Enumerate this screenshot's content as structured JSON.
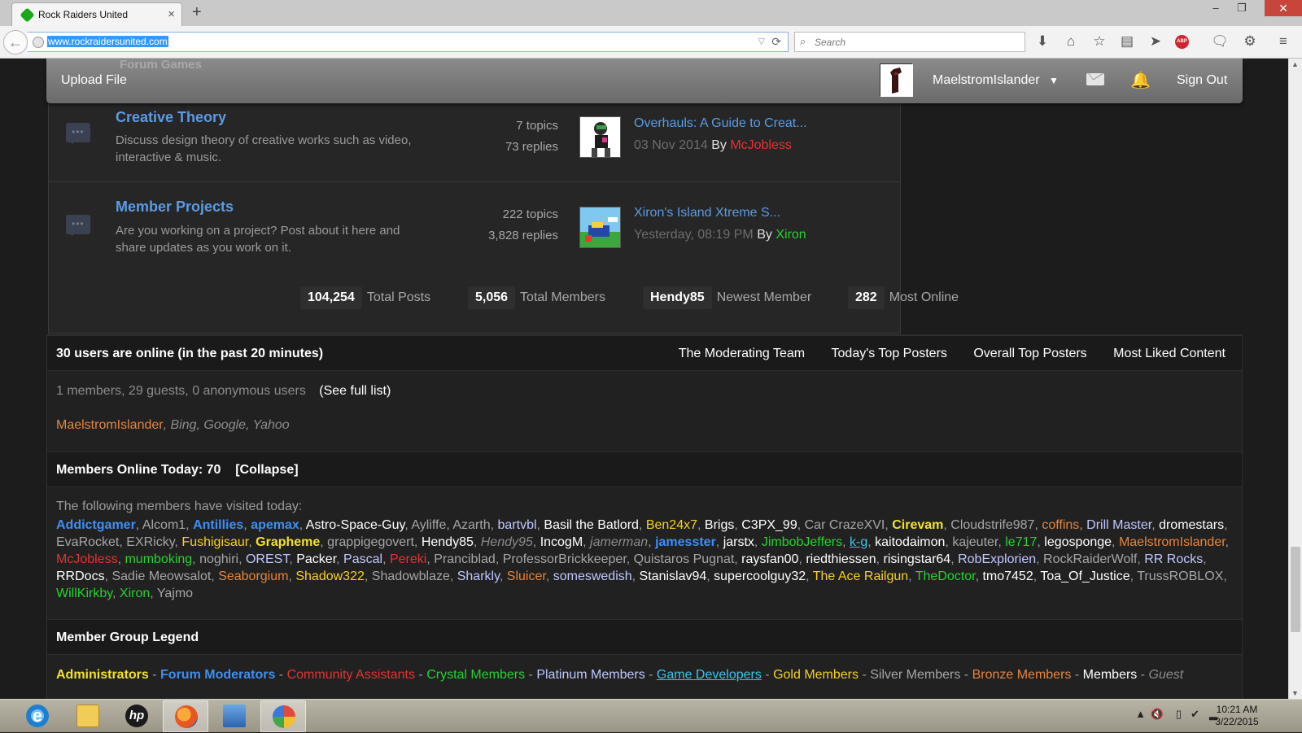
{
  "browser": {
    "tab_title": "Rock Raiders United",
    "tab_close": "×",
    "new_tab": "+",
    "url": "www.rockraidersunited.com",
    "search_placeholder": "Search",
    "window_controls": [
      "–",
      "❐",
      "✕"
    ]
  },
  "sitebar": {
    "breadcrumb_ghost": "Forum Games",
    "upload_label": "Upload File",
    "username": "MaelstromIslander",
    "signout_label": "Sign Out",
    "icons": [
      "mail-icon",
      "bell-icon",
      "caret-down-icon"
    ]
  },
  "forums": [
    {
      "name": "Creative Theory",
      "description": "Discuss design theory of creative works such as video, interactive & music.",
      "topics": "7 topics",
      "replies": "73 replies",
      "last_title": "Overhauls: A Guide to Creat...",
      "last_date": "03 Nov 2014",
      "by": "By",
      "last_user": "McJobless",
      "last_user_color": "#e8302f"
    },
    {
      "name": "Member Projects",
      "description": "Are you working on a project? Post about it here and share updates as you work on it.",
      "topics": "222 topics",
      "replies": "3,828 replies",
      "last_title": "Xiron's Island Xtreme S...",
      "last_date": "Yesterday, 08:19 PM",
      "by": "By",
      "last_user": "Xiron",
      "last_user_color": "#27d32d"
    }
  ],
  "stats": [
    {
      "value": "104,254",
      "label": "Total Posts"
    },
    {
      "value": "5,056",
      "label": "Total Members"
    },
    {
      "value": "Hendy85",
      "label": "Newest Member"
    },
    {
      "value": "282",
      "label": "Most Online"
    }
  ],
  "online": {
    "title": "30 users are online (in the past 20 minutes)",
    "links": [
      "The Moderating Team",
      "Today's Top Posters",
      "Overall Top Posters",
      "Most Liked Content"
    ],
    "counts": "1 members, 29 guests, 0 anonymous users",
    "see_full": "(See full list)",
    "online_user": "MaelstromIslander",
    "bots": ", Bing, Google, Yahoo",
    "today_title": "Members Online Today: 70",
    "collapse": "[Collapse]",
    "visited_intro": "The following members have visited today:",
    "members": [
      {
        "n": "Addictgamer",
        "c": "mod"
      },
      {
        "n": "Alcom1",
        "c": "silver"
      },
      {
        "n": "Antillies",
        "c": "mod"
      },
      {
        "n": "apemax",
        "c": "mod"
      },
      {
        "n": "Astro-Space-Guy",
        "c": "member"
      },
      {
        "n": "Ayliffe",
        "c": "silver"
      },
      {
        "n": "Azarth",
        "c": "silver"
      },
      {
        "n": "bartvbl",
        "c": "plat"
      },
      {
        "n": "Basil the Batlord",
        "c": "member"
      },
      {
        "n": "Ben24x7",
        "c": "gold"
      },
      {
        "n": "Brigs",
        "c": "member"
      },
      {
        "n": "C3PX_99",
        "c": "member"
      },
      {
        "n": "Car CrazeXVI",
        "c": "silver"
      },
      {
        "n": "Cirevam",
        "c": "admin"
      },
      {
        "n": "Cloudstrife987",
        "c": "silver"
      },
      {
        "n": "coffins",
        "c": "bronze"
      },
      {
        "n": "Drill Master",
        "c": "plat"
      },
      {
        "n": "dromestars",
        "c": "member"
      },
      {
        "n": "EvaRocket",
        "c": "silver"
      },
      {
        "n": "EXRicky",
        "c": "silver"
      },
      {
        "n": "Fushigisaur",
        "c": "gold"
      },
      {
        "n": "Grapheme",
        "c": "admin"
      },
      {
        "n": "grappigegovert",
        "c": "silver"
      },
      {
        "n": "Hendy85",
        "c": "member"
      },
      {
        "n": "Hendy95",
        "c": "guest"
      },
      {
        "n": "IncogM",
        "c": "member"
      },
      {
        "n": "jamerman",
        "c": "guest"
      },
      {
        "n": "jamesster",
        "c": "mod"
      },
      {
        "n": "jarstx",
        "c": "member"
      },
      {
        "n": "JimbobJeffers",
        "c": "crystal"
      },
      {
        "n": "k-g",
        "c": "dev"
      },
      {
        "n": "kaitodaimon",
        "c": "member"
      },
      {
        "n": "kajeuter",
        "c": "silver"
      },
      {
        "n": "le717",
        "c": "crystal"
      },
      {
        "n": "legosponge",
        "c": "member"
      },
      {
        "n": "MaelstromIslander",
        "c": "bronze"
      },
      {
        "n": "McJobless",
        "c": "comm"
      },
      {
        "n": "mumboking",
        "c": "crystal"
      },
      {
        "n": "noghiri",
        "c": "silver"
      },
      {
        "n": "OREST",
        "c": "plat"
      },
      {
        "n": "Packer",
        "c": "member"
      },
      {
        "n": "Pascal",
        "c": "plat"
      },
      {
        "n": "Pereki",
        "c": "comm"
      },
      {
        "n": "Pranciblad",
        "c": "silver"
      },
      {
        "n": "ProfessorBrickkeeper",
        "c": "silver"
      },
      {
        "n": "Quistaros Pugnat",
        "c": "silver"
      },
      {
        "n": "raysfan00",
        "c": "member"
      },
      {
        "n": "riedthiessen",
        "c": "member"
      },
      {
        "n": "risingstar64",
        "c": "member"
      },
      {
        "n": "RobExplorien",
        "c": "plat"
      },
      {
        "n": "RockRaiderWolf",
        "c": "silver"
      },
      {
        "n": "RR Rocks",
        "c": "plat"
      },
      {
        "n": "RRDocs",
        "c": "member"
      },
      {
        "n": "Sadie Meowsalot",
        "c": "silver"
      },
      {
        "n": "Seaborgium",
        "c": "bronze"
      },
      {
        "n": "Shadow322",
        "c": "gold"
      },
      {
        "n": "Shadowblaze",
        "c": "silver"
      },
      {
        "n": "Sharkly",
        "c": "plat"
      },
      {
        "n": "Sluicer",
        "c": "bronze"
      },
      {
        "n": "someswedish",
        "c": "plat"
      },
      {
        "n": "Stanislav94",
        "c": "member"
      },
      {
        "n": "supercoolguy32",
        "c": "member"
      },
      {
        "n": "The Ace Railgun",
        "c": "gold"
      },
      {
        "n": "TheDoctor",
        "c": "crystal"
      },
      {
        "n": "tmo7452",
        "c": "member"
      },
      {
        "n": "Toa_Of_Justice",
        "c": "member"
      },
      {
        "n": "TrussROBLOX",
        "c": "silver"
      },
      {
        "n": "WillKirkby",
        "c": "crystal"
      },
      {
        "n": "Xiron",
        "c": "crystal"
      },
      {
        "n": "Yajmo",
        "c": "silver"
      }
    ],
    "legend_title": "Member Group Legend",
    "legend": [
      {
        "n": "Administrators",
        "c": "admin"
      },
      {
        "n": "Forum Moderators",
        "c": "mod"
      },
      {
        "n": "Community Assistants",
        "c": "comm"
      },
      {
        "n": "Crystal Members",
        "c": "crystal"
      },
      {
        "n": "Platinum Members",
        "c": "plat"
      },
      {
        "n": "Game Developers",
        "c": "dev"
      },
      {
        "n": "Gold Members",
        "c": "gold"
      },
      {
        "n": "Silver Members",
        "c": "silver"
      },
      {
        "n": "Bronze Members",
        "c": "bronze"
      },
      {
        "n": "Members",
        "c": "member"
      },
      {
        "n": "Guest",
        "c": "guest"
      }
    ]
  },
  "taskbar": {
    "time": "10:21 AM",
    "date": "3/22/2015",
    "apps": [
      "internet-explorer-icon",
      "file-explorer-icon",
      "hp-icon",
      "firefox-icon",
      "paint-icon",
      "control-panel-icon"
    ]
  },
  "colors": {
    "link_blue": "#5b9be4",
    "page_bg": "#1c1c1c",
    "panel_bg": "#262626"
  }
}
